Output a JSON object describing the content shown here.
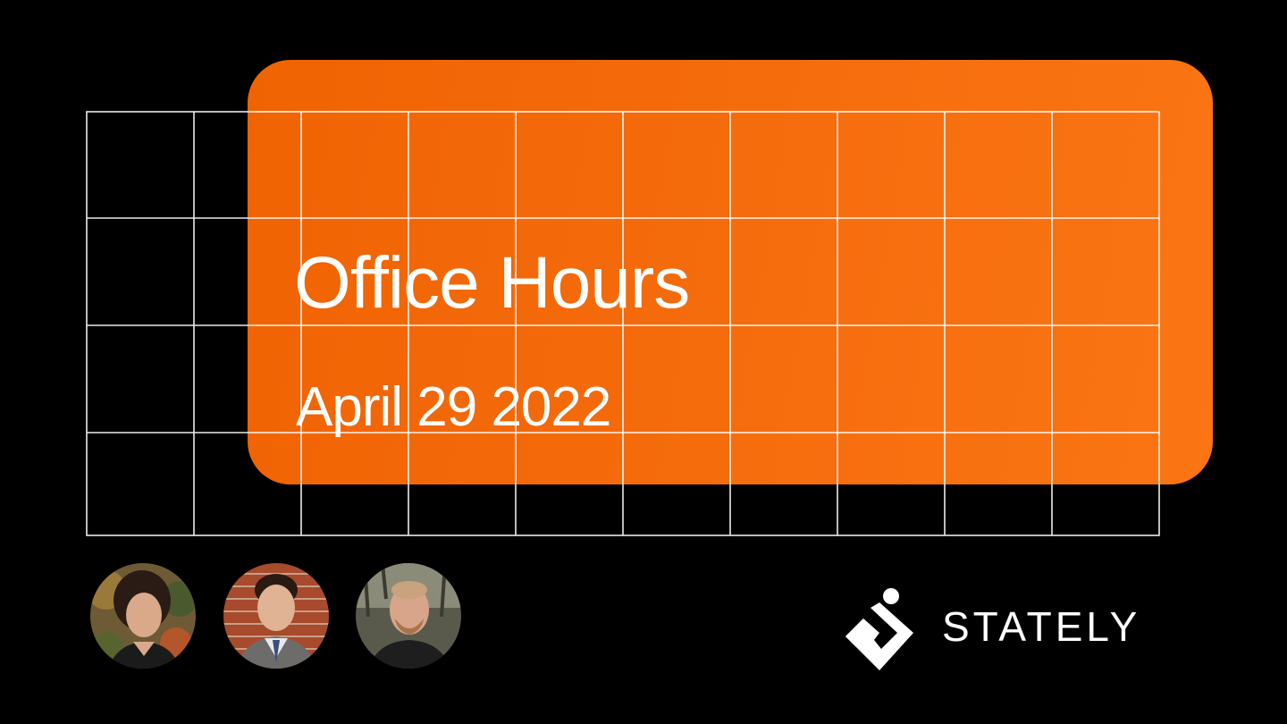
{
  "slide": {
    "title": "Office Hours",
    "subtitle": "April 29 2022"
  },
  "colors": {
    "background": "#000000",
    "accent": "#f56c0d",
    "grid_lines": "#ffffff",
    "text": "#ffffff"
  },
  "hosts": [
    {
      "icon": "host-avatar-photo"
    },
    {
      "icon": "host-avatar-photo"
    },
    {
      "icon": "host-avatar-photo"
    }
  ],
  "brand": {
    "name": "STATELY",
    "icon": "stately-logo-mark"
  }
}
